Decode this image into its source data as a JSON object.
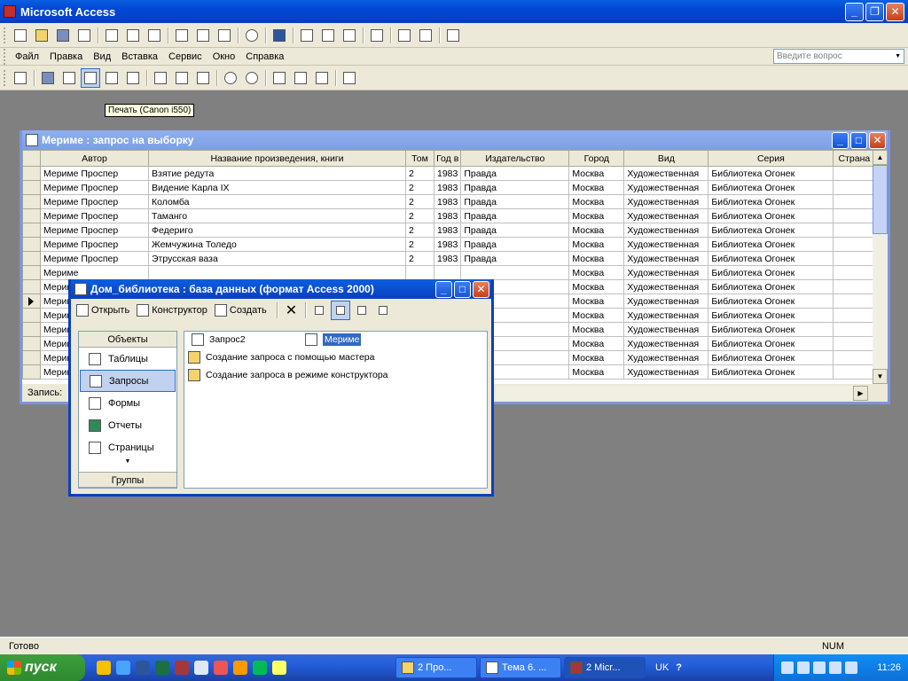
{
  "app": {
    "title": "Microsoft Access"
  },
  "menu": {
    "items": [
      "Файл",
      "Правка",
      "Вид",
      "Вставка",
      "Сервис",
      "Окно",
      "Справка"
    ],
    "ask_placeholder": "Введите вопрос"
  },
  "tooltip": {
    "text": "Печать (Canon i550)"
  },
  "query_window": {
    "title": "Мериме : запрос на выборку",
    "columns": [
      "Автор",
      "Название произведения, книги",
      "Том",
      "Год в",
      "Издательство",
      "Город",
      "Вид",
      "Серия",
      "Страна"
    ],
    "rows": [
      [
        "Мериме Проспер",
        "Взятие редута",
        "2",
        "1983",
        "Правда",
        "Москва",
        "Художественная",
        "Библиотека Огонек",
        ""
      ],
      [
        "Мериме Проспер",
        "Видение Карла IX",
        "2",
        "1983",
        "Правда",
        "Москва",
        "Художественная",
        "Библиотека Огонек",
        ""
      ],
      [
        "Мериме Проспер",
        "Коломба",
        "2",
        "1983",
        "Правда",
        "Москва",
        "Художественная",
        "Библиотека Огонек",
        ""
      ],
      [
        "Мериме Проспер",
        "Таманго",
        "2",
        "1983",
        "Правда",
        "Москва",
        "Художественная",
        "Библиотека Огонек",
        ""
      ],
      [
        "Мериме Проспер",
        "Федериго",
        "2",
        "1983",
        "Правда",
        "Москва",
        "Художественная",
        "Библиотека Огонек",
        ""
      ],
      [
        "Мериме Проспер",
        "Жемчужина Толедо",
        "2",
        "1983",
        "Правда",
        "Москва",
        "Художественная",
        "Библиотека Огонек",
        ""
      ],
      [
        "Мериме Проспер",
        "Этрусская ваза",
        "2",
        "1983",
        "Правда",
        "Москва",
        "Художественная",
        "Библиотека Огонек",
        ""
      ],
      [
        "Мериме",
        "",
        "",
        "",
        "",
        "Москва",
        "Художественная",
        "Библиотека Огонек",
        ""
      ],
      [
        "Мериме",
        "",
        "",
        "",
        "",
        "Москва",
        "Художественная",
        "Библиотека Огонек",
        ""
      ],
      [
        "Мериме",
        "",
        "",
        "",
        "",
        "Москва",
        "Художественная",
        "Библиотека Огонек",
        ""
      ],
      [
        "Мериме",
        "",
        "",
        "",
        "",
        "Москва",
        "Художественная",
        "Библиотека Огонек",
        ""
      ],
      [
        "Мериме",
        "",
        "",
        "",
        "",
        "Москва",
        "Художественная",
        "Библиотека Огонек",
        ""
      ],
      [
        "Мериме",
        "",
        "",
        "",
        "",
        "Москва",
        "Художественная",
        "Библиотека Огонек",
        ""
      ],
      [
        "Мериме",
        "",
        "",
        "",
        "",
        "Москва",
        "Художественная",
        "Библиотека Огонек",
        ""
      ],
      [
        "Мериме",
        "",
        "",
        "",
        "",
        "Москва",
        "Художественная",
        "Библиотека Огонек",
        ""
      ]
    ],
    "record_label": "Запись:"
  },
  "db_window": {
    "title": "Дом_библиотека : база данных (формат Access 2000)",
    "toolbar": {
      "open": "Открыть",
      "design": "Конструктор",
      "create": "Создать"
    },
    "objects_header": "Объекты",
    "objects": [
      "Таблицы",
      "Запросы",
      "Формы",
      "Отчеты",
      "Страницы"
    ],
    "groups_label": "Группы",
    "items": {
      "query1": "Запрос2",
      "query2": "Мериме",
      "wizard": "Создание запроса с помощью мастера",
      "designer": "Создание запроса в режиме конструктора"
    }
  },
  "status": {
    "text": "Готово",
    "num": "NUM"
  },
  "taskbar": {
    "start": "пуск",
    "tasks": [
      "2 Про...",
      "Тема 6. ...",
      "2 Micr..."
    ],
    "lang": "UK",
    "clock": "11:26"
  }
}
